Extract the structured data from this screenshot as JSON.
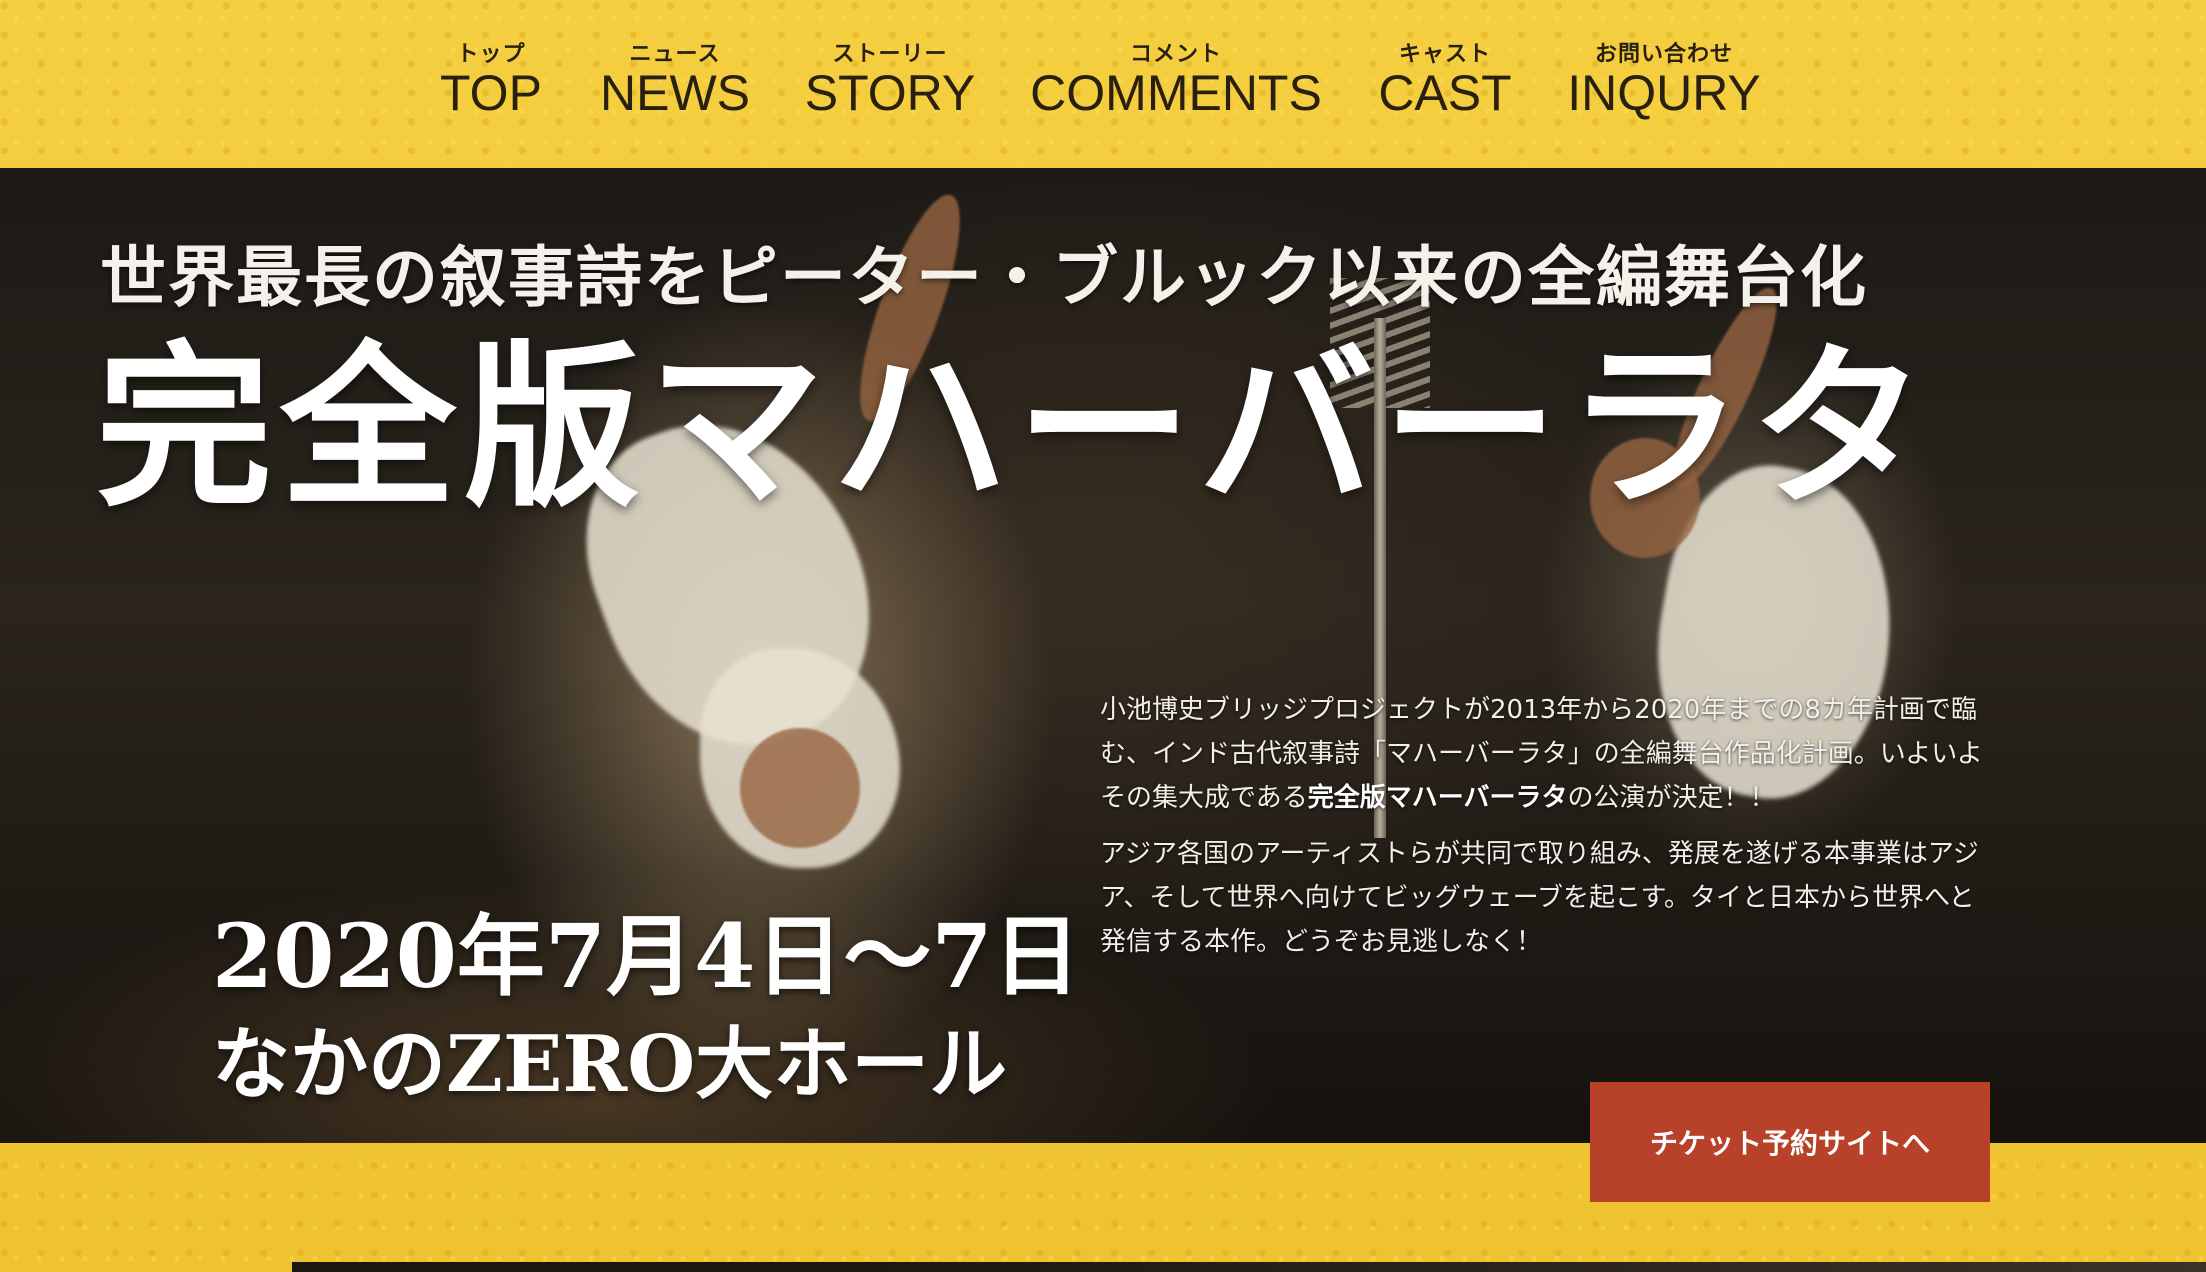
{
  "nav": [
    {
      "kana": "トップ",
      "label": "TOP"
    },
    {
      "kana": "ニュース",
      "label": "NEWS"
    },
    {
      "kana": "ストーリー",
      "label": "STORY"
    },
    {
      "kana": "コメント",
      "label": "COMMENTS"
    },
    {
      "kana": "キャスト",
      "label": "CAST"
    },
    {
      "kana": "お問い合わせ",
      "label": "INQURY"
    }
  ],
  "hero": {
    "subtitle": "世界最長の叙事詩をピーター・ブルック以来の全編舞台化",
    "title": "完全版マハーバーラタ",
    "date": "2020年7月4日～7日",
    "venue": "なかのZERO大ホール",
    "desc1_a": "小池博史ブリッジプロジェクトが2013年から2020年までの8カ年計画で臨む、インド古代叙事詩「マハーバーラタ」の全編舞台作品化計画。いよいよその集大成である",
    "desc1_strong": "完全版マハーバーラタ",
    "desc1_b": "の公演が決定！！",
    "desc2": "アジア各国のアーティストらが共同で取り組み、発展を遂げる本事業はアジア、そして世界へ向けてビッグウェーブを起こす。タイと日本から世界へと発信する本作。どうぞお見逃しなく！"
  },
  "cta": {
    "label": "チケット予約サイトへ"
  },
  "colors": {
    "background": "#f2c93a",
    "cta": "#b8412a",
    "nav_text": "#2a2010"
  }
}
